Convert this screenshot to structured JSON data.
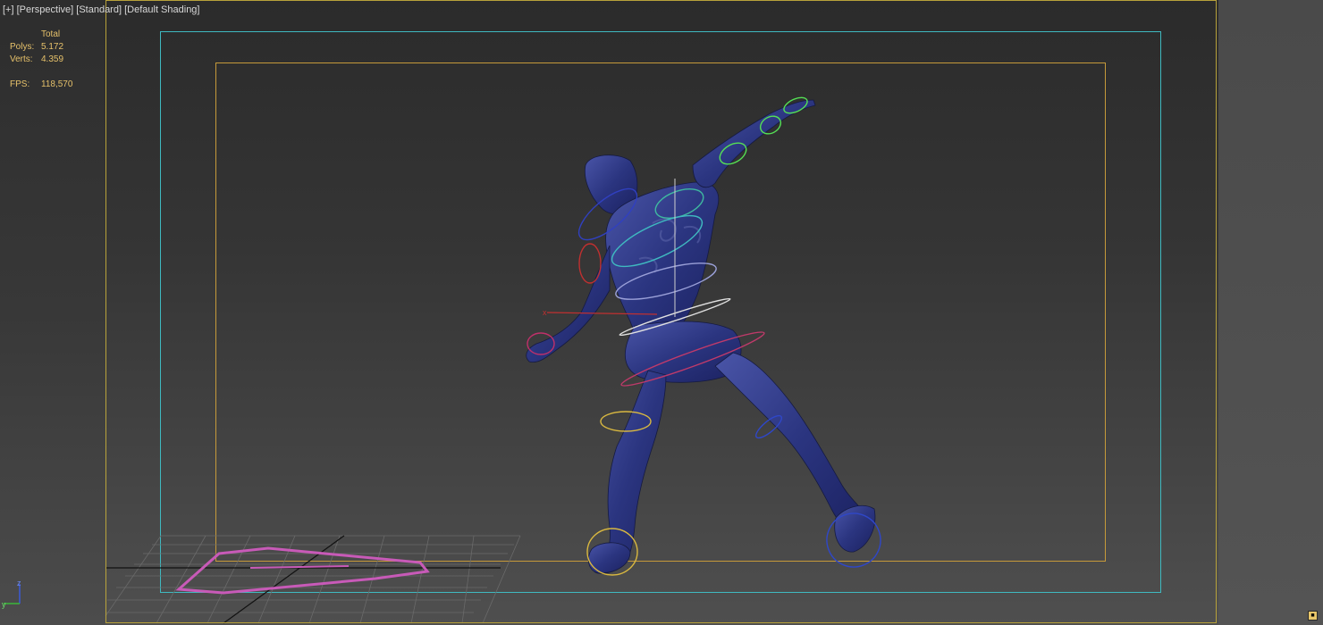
{
  "viewport": {
    "labels": {
      "menu": "[+]",
      "view": "[Perspective]",
      "style": "[Standard]",
      "shading": "[Default Shading]"
    }
  },
  "stats": {
    "header": "Total",
    "polys_label": "Polys:",
    "polys_value": "5.172",
    "verts_label": "Verts:",
    "verts_value": "4.359",
    "fps_label": "FPS:",
    "fps_value": "118,570"
  },
  "gizmo": {
    "x_label": "x",
    "y_label": "y",
    "axis_tripod_z": "z",
    "axis_tripod_x": "x"
  },
  "colors": {
    "safe_frame_outer": "#3fb9c0",
    "safe_frame_inner": "#c69a3a",
    "character_body": "#2b3580",
    "ground_rig": "#c85ab8",
    "stats_text": "#e6c16a"
  }
}
